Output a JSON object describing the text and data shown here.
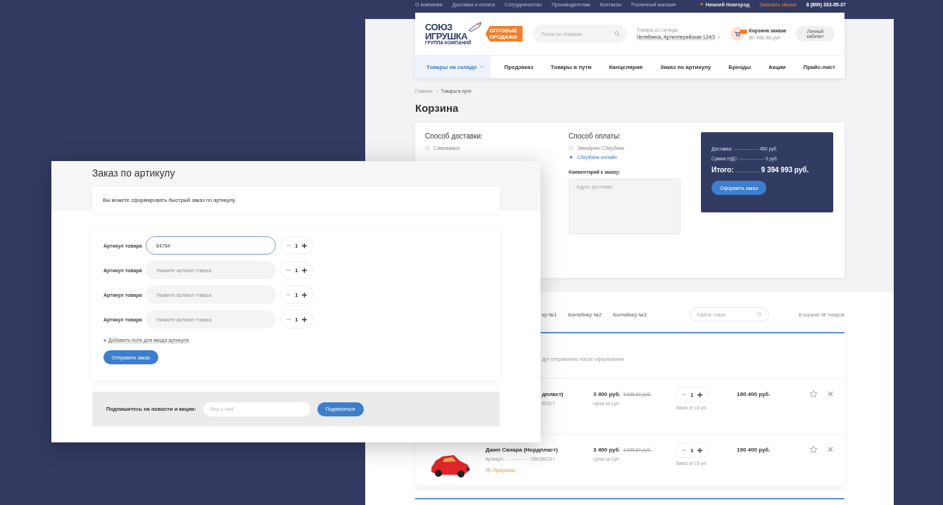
{
  "top_links": [
    "О компании",
    "Доставка и оплата",
    "Сотрудничество",
    "Производителям",
    "Контакты",
    "Розничный магазин"
  ],
  "location": "Нижний Новгород",
  "callback_link": "Заказать звонок",
  "phone": "8 (800) 333-55-37",
  "header": {
    "logo": {
      "line1": "СОЮЗ",
      "line2": "ИГРУШКА",
      "line3": "ГРУППА КОМПАНИЙ",
      "tag": "ОПТОВЫЕ ПРОДАЖИ"
    },
    "search_placeholder": "Поиск по товарам",
    "warehouse_label": "Товары со склада:",
    "warehouse": "Челябинск, Артиллерийская 124/2",
    "cart_title": "Корзина заказа",
    "cart_sum": "80 488.48 руб",
    "account_button": "Личный кабинет"
  },
  "nav": [
    {
      "label": "Товары на складе",
      "selected": true
    },
    {
      "label": "Предзаказ",
      "selected": false
    },
    {
      "label": "Товары в пути",
      "selected": false
    },
    {
      "label": "Канцелярия",
      "selected": false
    },
    {
      "label": "Заказ по артикулу",
      "selected": false
    },
    {
      "label": "Бренды",
      "selected": false
    },
    {
      "label": "Акции",
      "selected": false
    },
    {
      "label": "Прайс-лист",
      "selected": false
    }
  ],
  "breadcrumbs": [
    "Главная",
    "Товары в пути"
  ],
  "page_title": "Корзина",
  "delivery": {
    "title": "Способ доставки:",
    "options": [
      {
        "label": "Самовывоз",
        "selected": false
      }
    ]
  },
  "payment": {
    "title": "Способ оплаты:",
    "options": [
      {
        "label": "Эквайринг Сбербанк",
        "selected": false
      },
      {
        "label": "Сбербанк онлайн",
        "selected": true
      }
    ],
    "comment_label": "Комментарий к заказу:",
    "comment_placeholder": "Адрес доставки"
  },
  "summary": {
    "rows": [
      {
        "label": "Доставка:",
        "value": "450 руб.",
        "kind": "normal"
      },
      {
        "label": "Сумма НДС:",
        "value": "0 руб.",
        "kind": "normal"
      },
      {
        "label": "Итого:",
        "value": "9 394 993 руб.",
        "kind": "total"
      }
    ],
    "button": "Оформить заказ"
  },
  "containers": {
    "tabs": [
      "ер №1",
      "Контейнер №2",
      "Контейнер №3"
    ],
    "search_placeholder": "Найти товар",
    "count": "В корзине 48 товаров"
  },
  "note": "дут отправлены после оформления",
  "items": [
    {
      "kind": "cut",
      "name": "дпласт)",
      "article": "60317",
      "price": "3 400 руб.",
      "old_price": "3 699,54 руб.",
      "price_note": "Цена за 1уп.",
      "qty": "1",
      "min_order": "Заказ от 10 уп.",
      "total": "190 400 руб."
    },
    {
      "kind": "full",
      "name": "Джип Сахара (Нордпласт)",
      "article_label": "Артикул:",
      "article": "OBL560317",
      "status": "Предзаказ",
      "price": "3 400 руб.",
      "old_price": "3 699,54 руб.",
      "price_note": "Цена за 1уп.",
      "qty": "1",
      "min_order": "Заказ от 10 уп.",
      "total": "190 400 руб."
    }
  ],
  "quick_order": {
    "title": "Заказ по артикулу",
    "intro": "Вы можете сформировать быстрый заказ по артикулу.",
    "rows": [
      {
        "label": "Артикул товара",
        "value": "64764",
        "focused": true,
        "qty": "1"
      },
      {
        "label": "Артикул товара",
        "placeholder": "Укажите артикул товара",
        "focused": false,
        "qty": "1"
      },
      {
        "label": "Артикул товара",
        "placeholder": "Укажите артикул товара",
        "focused": false,
        "qty": "1"
      },
      {
        "label": "Артикул товара",
        "placeholder": "Укажите артикул товара",
        "focused": false,
        "qty": "1"
      }
    ],
    "add_link": "Добавить поле для ввода артикула",
    "submit": "Отправить заказ",
    "subscribe": {
      "label": "Подпишитесь на новости и акции:",
      "placeholder": "Ваш e-mail",
      "button": "Подписаться"
    }
  }
}
